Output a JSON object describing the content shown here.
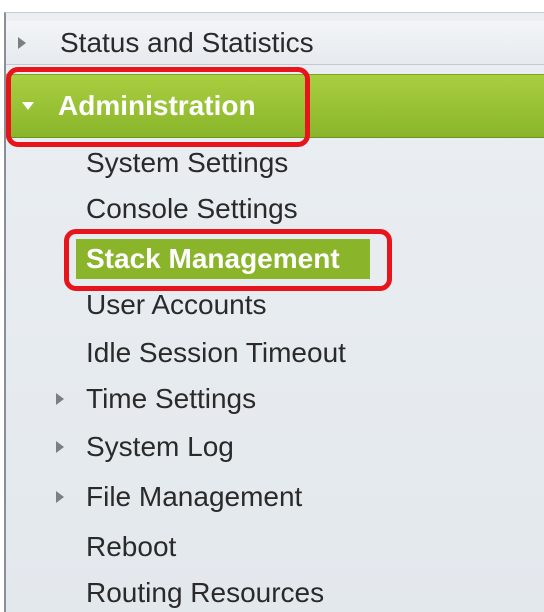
{
  "menu": {
    "status_and_statistics": "Status and Statistics",
    "administration": "Administration",
    "administration_items": {
      "system_settings": "System Settings",
      "console_settings": "Console Settings",
      "stack_management": "Stack Management",
      "user_accounts": "User Accounts",
      "idle_session_timeout": "Idle Session Timeout",
      "time_settings": "Time Settings",
      "system_log": "System Log",
      "file_management": "File Management",
      "reboot": "Reboot",
      "routing_resources": "Routing Resources"
    }
  },
  "icons": {
    "collapsed": "triangle-right-icon",
    "expanded": "triangle-down-icon"
  },
  "colors": {
    "selected_green": "#8ab52a",
    "highlight_red": "#e8141c"
  }
}
